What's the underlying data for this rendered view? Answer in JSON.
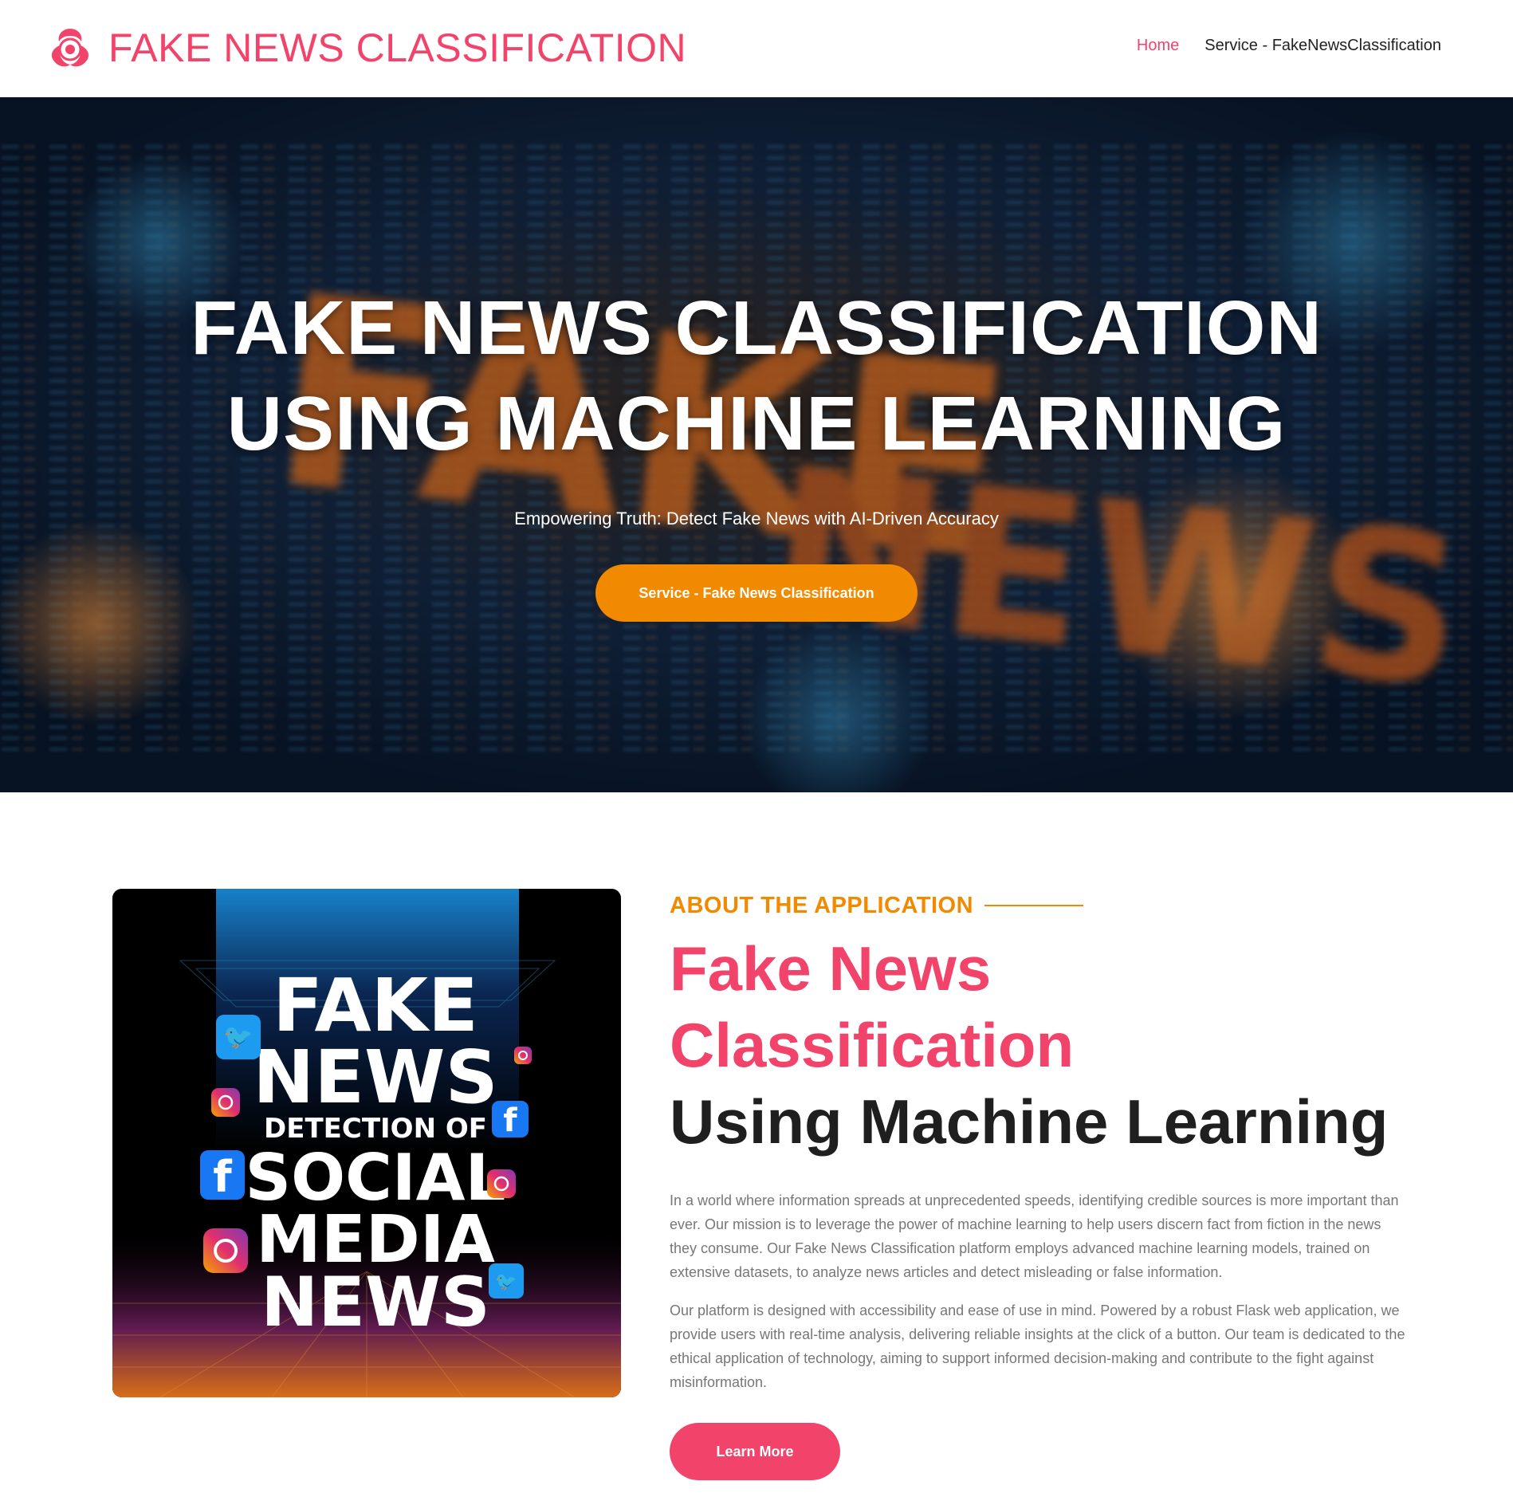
{
  "header": {
    "brand_title": "FAKE NEWS CLASSIFICATION",
    "brand_icon": "biohazard-icon",
    "nav": [
      {
        "label": "Home",
        "active": true
      },
      {
        "label": "Service - FakeNewsClassification",
        "active": false
      }
    ]
  },
  "hero": {
    "title_line1": "FAKE NEWS CLASSIFICATION",
    "title_line2": "USING MACHINE LEARNING",
    "subtitle": "Empowering Truth: Detect Fake News with AI-Driven Accuracy",
    "button_label": "Service - Fake News Classification",
    "background_word": "FAKE NEWS"
  },
  "about": {
    "eyebrow": "ABOUT THE APPLICATION",
    "heading_pink": "Fake News Classification",
    "heading_dark": "Using Machine Learning",
    "paragraph1": "In a world where information spreads at unprecedented speeds, identifying credible sources is more important than ever. Our mission is to leverage the power of machine learning to help users discern fact from fiction in the news they consume. Our Fake News Classification platform employs advanced machine learning models, trained on extensive datasets, to analyze news articles and detect misleading or false information.",
    "paragraph2": "Our platform is designed with accessibility and ease of use in mind. Powered by a robust Flask web application, we provide users with real-time analysis, delivering reliable insights at the click of a button. Our team is dedicated to the ethical application of technology, aiming to support informed decision-making and contribute to the fight against misinformation.",
    "button_label": "Learn More",
    "image": {
      "line1": "FAKE",
      "line2": "NEWS",
      "line3": "DETECTION OF",
      "line4": "SOCIAL",
      "line5": "MEDIA",
      "line6": "NEWS",
      "icons": [
        "twitter-icon",
        "instagram-icon",
        "facebook-icon"
      ]
    }
  },
  "colors": {
    "brand_pink": "#f2436b",
    "accent_orange": "#f28a00"
  }
}
